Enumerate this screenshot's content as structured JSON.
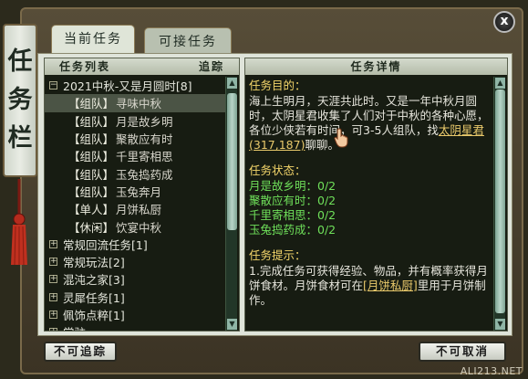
{
  "window": {
    "title_chars": [
      "任",
      "务",
      "栏"
    ],
    "close_label": "x"
  },
  "tabs": [
    {
      "label": "当前任务",
      "active": true
    },
    {
      "label": "可接任务",
      "active": false
    }
  ],
  "quest_list": {
    "header_left": "任务列表",
    "header_right": "追踪",
    "rows": [
      {
        "kind": "group",
        "expanded": true,
        "label": "2021中秋-又是月圆时[8]"
      },
      {
        "kind": "item",
        "tag": "【组队】",
        "name": "寻味中秋",
        "selected": true
      },
      {
        "kind": "item",
        "tag": "【组队】",
        "name": "月是故乡明"
      },
      {
        "kind": "item",
        "tag": "【组队】",
        "name": "聚散应有时"
      },
      {
        "kind": "item",
        "tag": "【组队】",
        "name": "千里寄相思"
      },
      {
        "kind": "item",
        "tag": "【组队】",
        "name": "玉兔捣药成"
      },
      {
        "kind": "item",
        "tag": "【组队】",
        "name": "玉兔奔月"
      },
      {
        "kind": "item",
        "tag": "【单人】",
        "name": "月饼私厨"
      },
      {
        "kind": "item",
        "tag": "【休闲】",
        "name": "饮宴中秋"
      },
      {
        "kind": "group",
        "expanded": false,
        "label": "常规回流任务[1]"
      },
      {
        "kind": "group",
        "expanded": false,
        "label": "常规玩法[2]"
      },
      {
        "kind": "group",
        "expanded": false,
        "label": "混沌之家[3]"
      },
      {
        "kind": "group",
        "expanded": false,
        "label": "灵犀任务[1]"
      },
      {
        "kind": "group",
        "expanded": false,
        "label": "佩饰点粹[1]"
      },
      {
        "kind": "group",
        "expanded": false,
        "label": "常驻"
      }
    ]
  },
  "details": {
    "header": "任务详情",
    "objective_title": "任务目的：",
    "objective_text_1": "海上生明月，天涯共此时。又是一年中秋月圆时，太阴星君收集了人们对于中秋的各种心愿，各位少侠若有时间，可3-5人组队，找",
    "npc_link": "太阴星君(317,187)",
    "objective_text_2": "聊聊。",
    "status_title": "任务状态：",
    "status_lines": [
      "月是故乡明：0/2",
      "聚散应有时：0/2",
      "千里寄相思：0/2",
      "玉兔捣药成：0/2"
    ],
    "hint_title": "任务提示：",
    "hint_text_1": "1.完成任务可获得经验、物品，并有概率获得月饼食材。月饼食材可在",
    "hint_link": "[月饼私厨]",
    "hint_text_2": "里用于月饼制作。"
  },
  "buttons": {
    "untrack": "不可追踪",
    "cancel": "不可取消"
  },
  "watermark": "ALI213.NET",
  "colors": {
    "status_green": "#6fe05a",
    "title_yellow": "#f3d56a",
    "link_gold": "#e9c96b"
  }
}
